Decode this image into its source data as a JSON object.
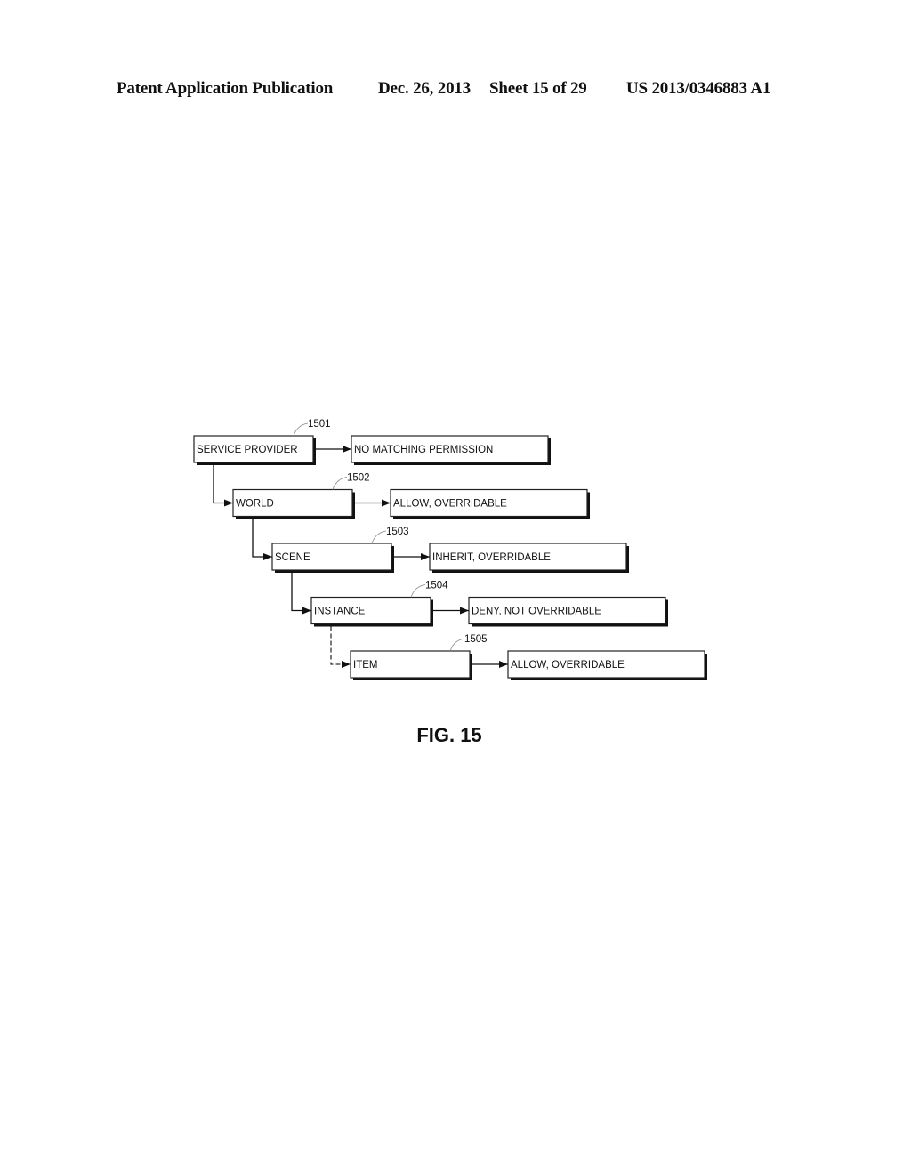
{
  "header": {
    "publication_type": "Patent Application Publication",
    "date": "Dec. 26, 2013",
    "sheet": "Sheet 15 of 29",
    "patent_number": "US 2013/0346883 A1"
  },
  "diagram": {
    "levels": [
      {
        "ref": "1501",
        "node": "SERVICE PROVIDER",
        "permission": "NO MATCHING PERMISSION",
        "link_from_parent": "none"
      },
      {
        "ref": "1502",
        "node": "WORLD",
        "permission": "ALLOW, OVERRIDABLE",
        "link_from_parent": "solid"
      },
      {
        "ref": "1503",
        "node": "SCENE",
        "permission": "INHERIT, OVERRIDABLE",
        "link_from_parent": "solid"
      },
      {
        "ref": "1504",
        "node": "INSTANCE",
        "permission": "DENY, NOT OVERRIDABLE",
        "link_from_parent": "solid"
      },
      {
        "ref": "1505",
        "node": "ITEM",
        "permission": "ALLOW, OVERRIDABLE",
        "link_from_parent": "dashed"
      }
    ]
  },
  "figure_label": "FIG. 15"
}
